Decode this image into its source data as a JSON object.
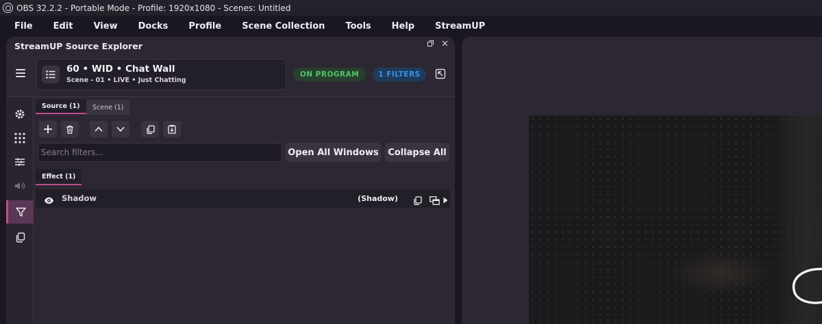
{
  "titlebar": {
    "title": "OBS 32.2.2 - Portable Mode - Profile: 1920x1080 - Scenes: Untitled"
  },
  "menu": {
    "items": [
      "File",
      "Edit",
      "View",
      "Docks",
      "Profile",
      "Scene Collection",
      "Tools",
      "Help",
      "StreamUP"
    ]
  },
  "dock": {
    "title": "StreamUP Source Explorer",
    "source": {
      "name": "60 • WID • Chat Wall",
      "subtitle": "Scene  -  01 • LIVE • Just Chatting"
    },
    "badges": {
      "program": "ON PROGRAM",
      "filters": "1 FILTERS"
    },
    "tabs": {
      "source": "Source (1)",
      "scene": "Scene (1)"
    },
    "search": {
      "placeholder": "Search filters..."
    },
    "buttons": {
      "open_all": "Open All Windows",
      "collapse_all": "Collapse All"
    },
    "effect_tab": "Effect (1)",
    "filter": {
      "name": "Shadow",
      "type": "(Shadow)"
    }
  },
  "colors": {
    "accent": "#c04d8d",
    "program_green": "#52c567",
    "filters_blue": "#3b93e6"
  },
  "icons": [
    "obs-logo-icon",
    "hamburger-icon",
    "list-icon",
    "popout-icon",
    "gear-icon",
    "grid-icon",
    "sliders-icon",
    "audio-icon",
    "filter-icon",
    "copy-icon",
    "add-icon",
    "trash-icon",
    "arrow-up-icon",
    "arrow-down-icon",
    "eye-icon",
    "expand-arrow-icon"
  ]
}
